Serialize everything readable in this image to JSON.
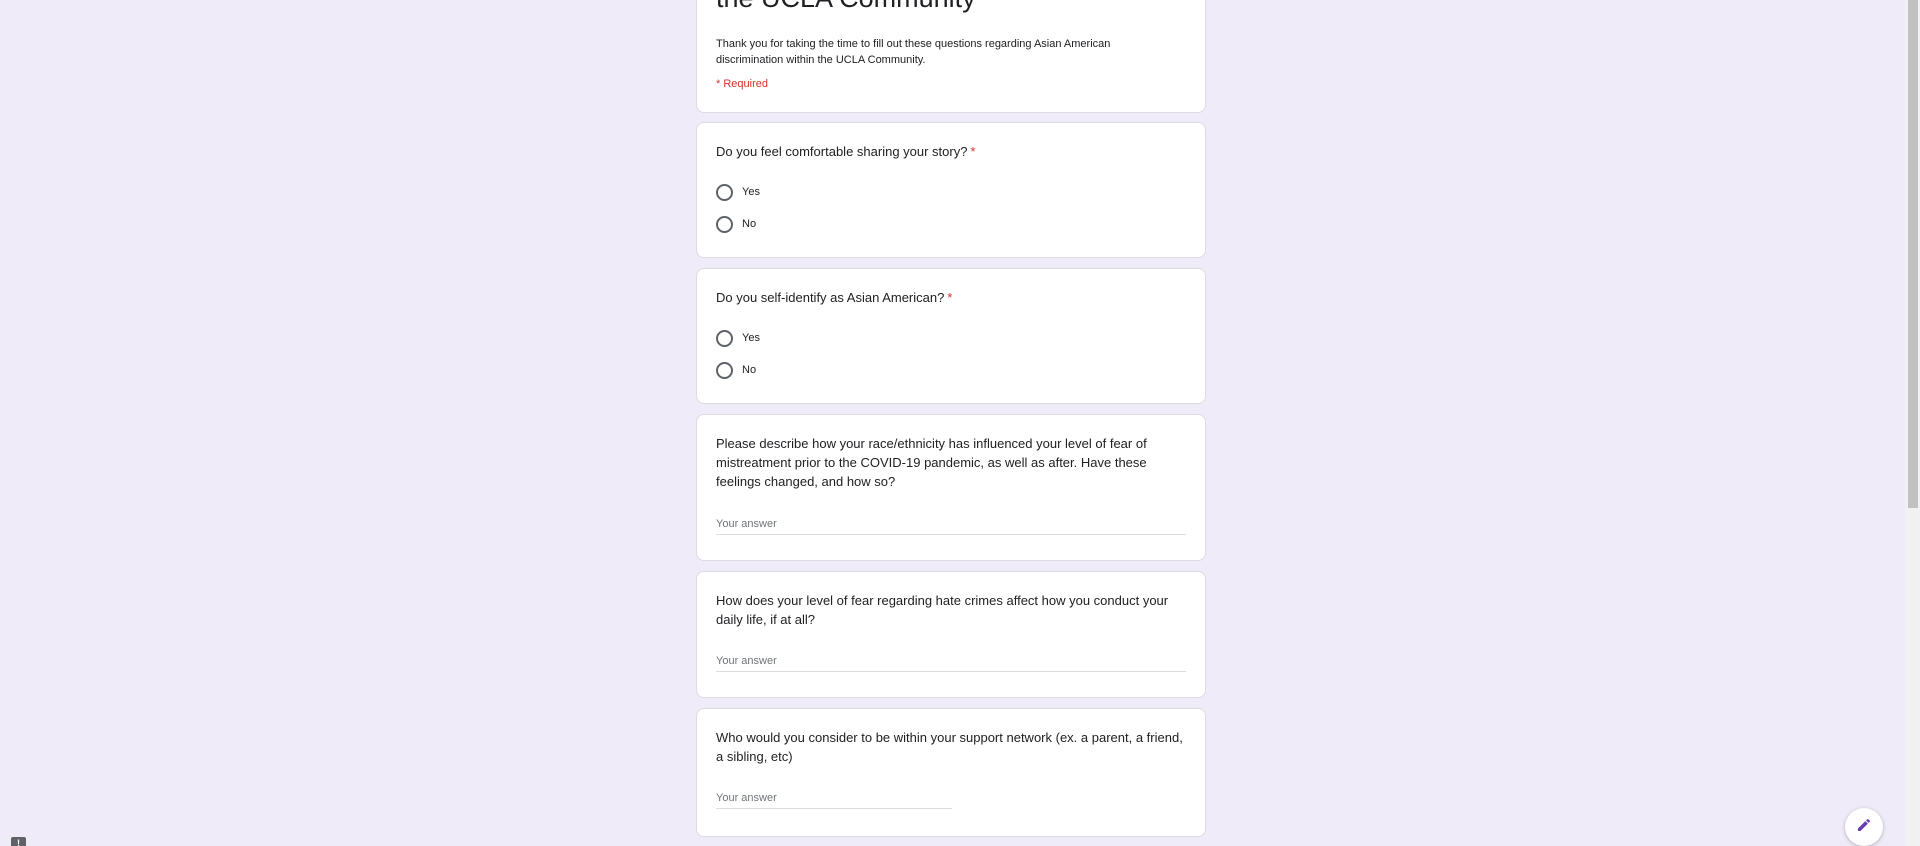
{
  "form": {
    "title": "the UCLA Community",
    "description": "Thank you for taking the time to fill out these questions regarding Asian American discrimination within the UCLA Community.",
    "required_note": "* Required",
    "answer_placeholder": "Your answer"
  },
  "questions": [
    {
      "title": "Do you feel comfortable sharing your story?",
      "required": "*",
      "options": [
        "Yes",
        "No"
      ]
    },
    {
      "title": "Do you self-identify as Asian American?",
      "required": "*",
      "options": [
        "Yes",
        "No"
      ]
    },
    {
      "title": "Please describe how your race/ethnicity has influenced your level of fear of mistreatment prior to the COVID-19 pandemic, as well as after. Have these feelings changed, and how so?"
    },
    {
      "title": "How does your level of fear regarding hate crimes affect how you conduct your daily life, if at all?"
    },
    {
      "title": "Who would you consider to be within your support network (ex. a parent, a friend, a sibling, etc)"
    }
  ],
  "icons": {
    "edit": "pencil-icon",
    "report": "report-icon"
  },
  "colors": {
    "background": "#f0ebf8",
    "required": "#d93025",
    "fab_icon": "#673ab7"
  }
}
